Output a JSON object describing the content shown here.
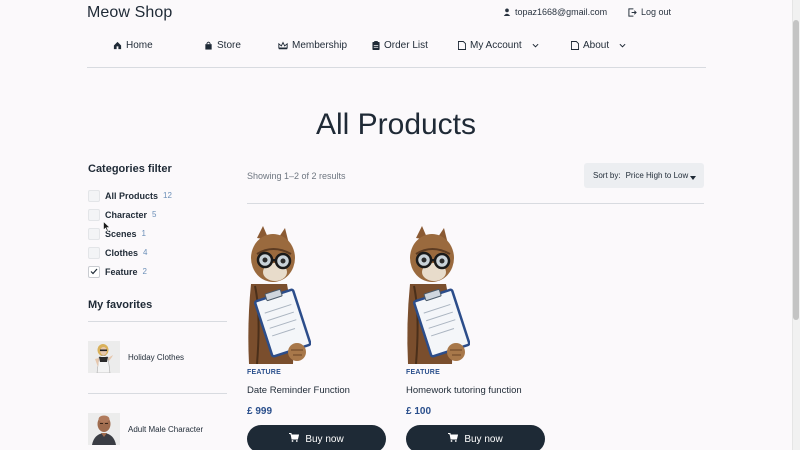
{
  "header": {
    "brand": "Meow Shop",
    "user_email": "topaz1668@gmail.com",
    "logout_label": "Log out"
  },
  "nav": {
    "items": [
      {
        "label": "Home",
        "icon": "home-icon"
      },
      {
        "label": "Store",
        "icon": "bag-icon"
      },
      {
        "label": "Membership",
        "icon": "crown-icon"
      },
      {
        "label": "Order List",
        "icon": "clipboard-icon"
      },
      {
        "label": "My Account",
        "icon": "document-icon",
        "dropdown": true
      },
      {
        "label": "About",
        "icon": "document-icon",
        "dropdown": true
      }
    ]
  },
  "page": {
    "title": "All Products"
  },
  "filters": {
    "title": "Categories filter",
    "categories": [
      {
        "label": "All Products",
        "count": "12",
        "checked": false
      },
      {
        "label": "Character",
        "count": "5",
        "checked": false
      },
      {
        "label": "Scenes",
        "count": "1",
        "checked": false
      },
      {
        "label": "Clothes",
        "count": "4",
        "checked": false
      },
      {
        "label": "Feature",
        "count": "2",
        "checked": true
      }
    ]
  },
  "favorites": {
    "title": "My favorites",
    "items": [
      {
        "label": "Holiday Clothes",
        "icon": "woman-figure-thumbnail"
      },
      {
        "label": "Adult Male Character",
        "icon": "bald-man-thumbnail"
      }
    ]
  },
  "results": {
    "showing": "Showing 1–2 of 2 results",
    "sort_label": "Sort by:",
    "sort_value": "Price High to Low"
  },
  "products": [
    {
      "tag": "FEATURE",
      "name": "Date Reminder Function",
      "price": "£ 999",
      "buy_label": "Buy now",
      "image": "cat-with-clipboard-image"
    },
    {
      "tag": "FEATURE",
      "name": "Homework tutoring function",
      "price": "£ 100",
      "buy_label": "Buy now",
      "image": "cat-with-clipboard-image"
    }
  ],
  "colors": {
    "dark_navy": "#1e2a36",
    "price_blue": "#2a4f8c",
    "count_blue": "#6b8fb8",
    "background": "#fbf9fb"
  }
}
